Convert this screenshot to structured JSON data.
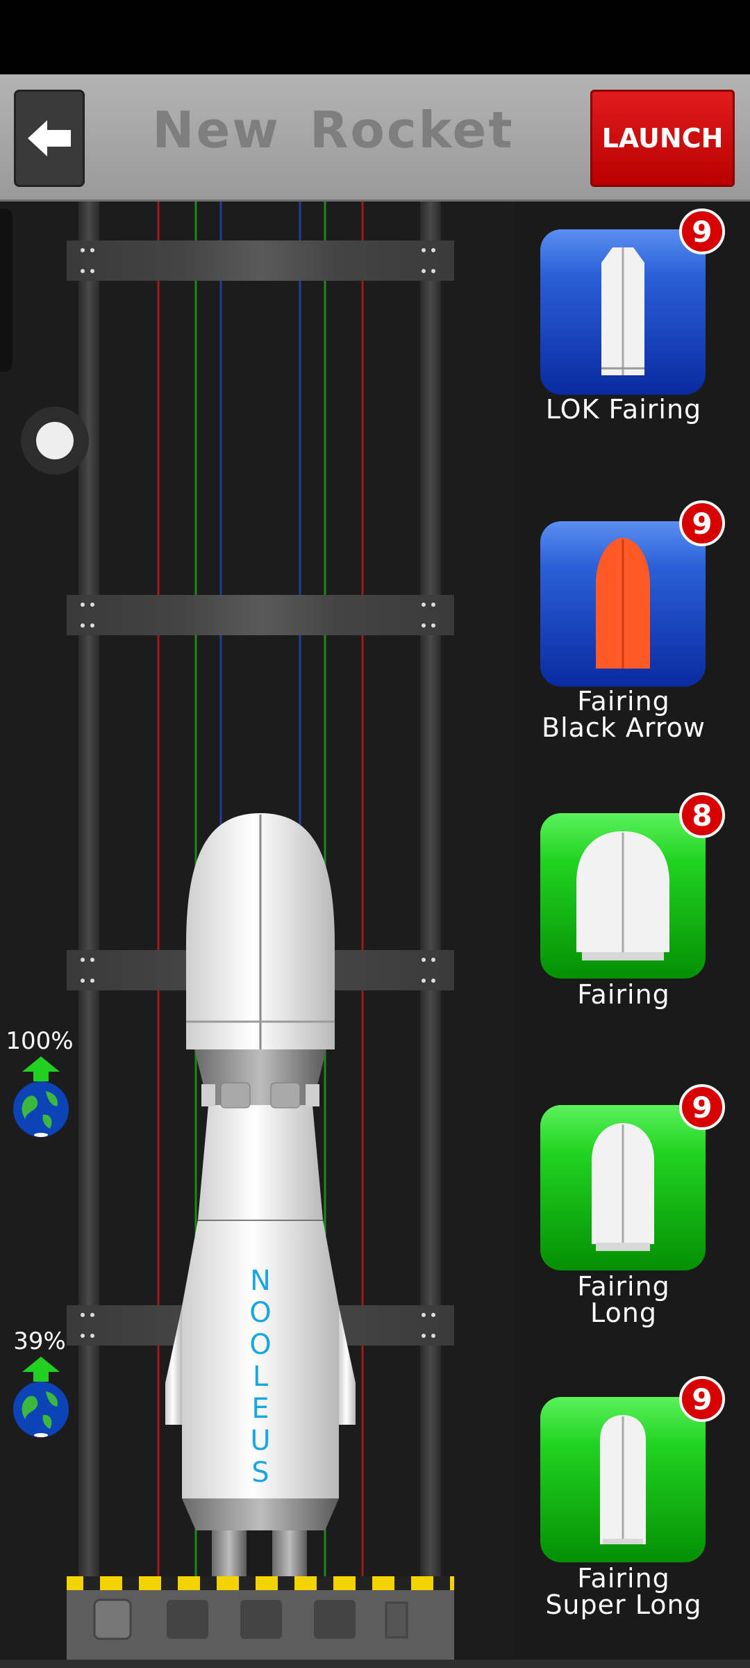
{
  "header": {
    "title": "New Rocket",
    "launch_label": "LAUNCH"
  },
  "rocket": {
    "name_letters": [
      "N",
      "O",
      "O",
      "L",
      "E",
      "U",
      "S"
    ]
  },
  "indicators": [
    {
      "percent": "100%"
    },
    {
      "percent": "39%"
    }
  ],
  "parts": [
    {
      "label_lines": [
        "LOK Fairing"
      ],
      "count": "9",
      "theme": "blue",
      "icon": "lok-fairing-icon"
    },
    {
      "label_lines": [
        "Fairing",
        "Black Arrow"
      ],
      "count": "9",
      "theme": "blue",
      "icon": "black-arrow-fairing-icon"
    },
    {
      "label_lines": [
        "Fairing"
      ],
      "count": "8",
      "theme": "green",
      "icon": "fairing-icon"
    },
    {
      "label_lines": [
        "Fairing",
        "Long"
      ],
      "count": "9",
      "theme": "green",
      "icon": "fairing-long-icon"
    },
    {
      "label_lines": [
        "Fairing",
        "Super Long"
      ],
      "count": "9",
      "theme": "green",
      "icon": "fairing-super-long-icon"
    }
  ],
  "colors": {
    "launch": "#d00000",
    "blue_tile": "#1a45c8",
    "green_tile": "#11c211",
    "badge": "#d80000"
  }
}
